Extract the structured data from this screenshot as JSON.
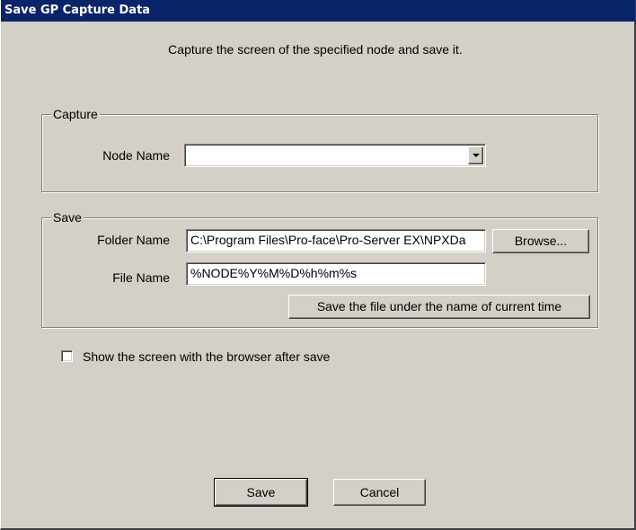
{
  "window": {
    "title": "Save GP Capture Data"
  },
  "description": "Capture the screen of the specified node and save it.",
  "capture_group": {
    "legend": "Capture",
    "node_name_label": "Node Name",
    "node_name_value": ""
  },
  "save_group": {
    "legend": "Save",
    "folder_label": "Folder Name",
    "folder_value": "C:\\Program Files\\Pro-face\\Pro-Server EX\\NPXDa",
    "browse_label": "Browse...",
    "file_label": "File Name",
    "file_value": "%NODE%Y%M%D%h%m%s",
    "current_time_label": "Save the file under the name of current time"
  },
  "options": {
    "show_browser_label": "Show the screen with the browser after save",
    "show_browser_checked": false
  },
  "footer": {
    "save_label": "Save",
    "cancel_label": "Cancel"
  },
  "icons": {
    "dropdown": "chevron-down-icon"
  }
}
